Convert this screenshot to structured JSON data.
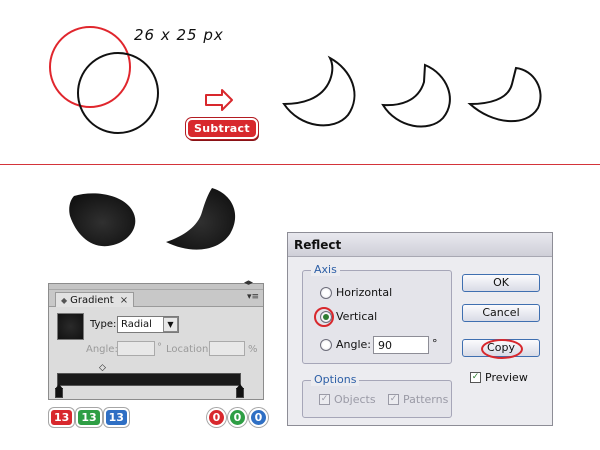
{
  "top_illustration": {
    "size_label": "26 x 25 px",
    "operation_badge": "Subtract"
  },
  "gradient_panel": {
    "tab_label": "Gradient",
    "close_symbol": "×",
    "type_label": "Type:",
    "type_value": "Radial",
    "angle_label": "Angle:",
    "angle_unit": "°",
    "location_label": "Location:",
    "location_unit": "%",
    "stops": [
      "#131313",
      "#131313"
    ]
  },
  "color_badges": {
    "rgb_left": [
      "13",
      "13",
      "13"
    ],
    "rgb_right": [
      "0",
      "0",
      "0"
    ],
    "colors": [
      "#d8282d",
      "#2e9e44",
      "#2f6fc4"
    ]
  },
  "reflect_dialog": {
    "title": "Reflect",
    "axis_legend": "Axis",
    "horizontal_label": "Horizontal",
    "vertical_label": "Vertical",
    "angle_label": "Angle:",
    "angle_value": "90",
    "angle_unit": "°",
    "options_legend": "Options",
    "objects_label": "Objects",
    "patterns_label": "Patterns",
    "ok_label": "OK",
    "cancel_label": "Cancel",
    "copy_label": "Copy",
    "preview_label": "Preview",
    "selected_axis": "Vertical",
    "preview_checked": true
  },
  "colors": {
    "highlight_red": "#d8282d",
    "divider": "#d4343a",
    "shape_fill": "#1c1c1c"
  }
}
